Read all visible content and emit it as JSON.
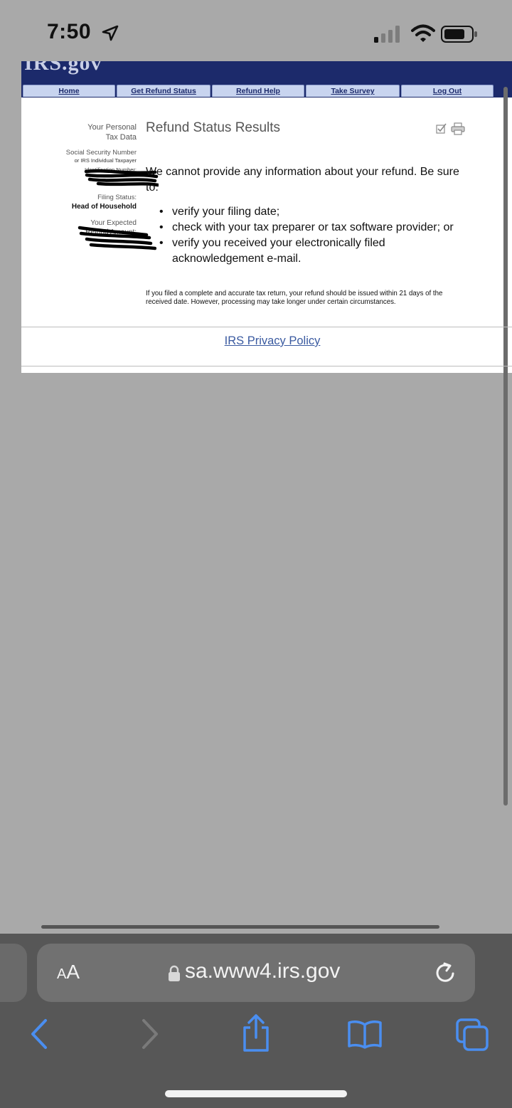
{
  "status_bar": {
    "time": "7:50"
  },
  "site": {
    "banner_logo": "IRS.gov",
    "nav": [
      {
        "label": "Home"
      },
      {
        "label": "Get Refund Status"
      },
      {
        "label": "Refund Help"
      },
      {
        "label": "Take Survey"
      },
      {
        "label": "Log Out"
      }
    ]
  },
  "sidebar": {
    "personal_data_line1": "Your Personal",
    "personal_data_line2": "Tax Data",
    "ssn_label": "Social Security Number",
    "ssn_sub": "or IRS Individual Taxpayer",
    "ssn_sub2": "Identification Number:",
    "filing_status_label": "Filing Status:",
    "filing_status_value": "Head of Household",
    "expected_line1": "Your Expected",
    "expected_line2": "Refund Amount:"
  },
  "main": {
    "title": "Refund Status Results",
    "message": "We cannot provide any information about your refund. Be sure to:",
    "bullets": [
      "verify your filing date;",
      "check with your tax preparer or tax software provider; or",
      "verify you received your electronically filed acknowledgement e-mail."
    ],
    "fineprint": "If you filed a complete and accurate tax return, your refund should be issued within 21 days of the received date. However, processing may take longer under certain circumstances.",
    "privacy_link": "IRS Privacy Policy"
  },
  "safari": {
    "aa_label_small": "A",
    "aa_label_large": "A",
    "url": "sa.www4.irs.gov"
  },
  "colors": {
    "banner": "#1c2a6b",
    "nav_tab": "#c8d4ef",
    "link": "#3a5aa0",
    "safari_tint": "#4a8ef0"
  }
}
